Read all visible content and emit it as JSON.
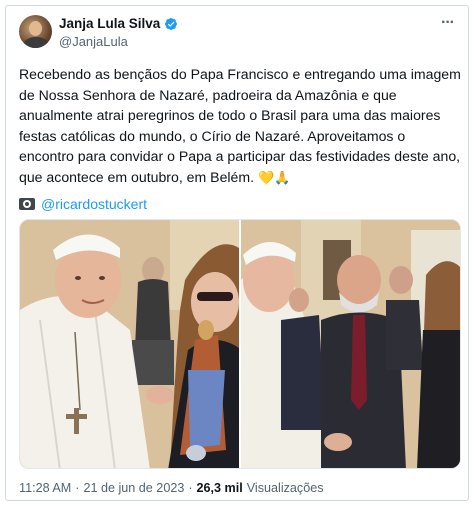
{
  "author": {
    "display_name": "Janja Lula Silva",
    "handle": "@JanjaLula",
    "verified": true
  },
  "tweet": {
    "text": "Recebendo as bençãos do Papa Francisco e entregando uma imagem de Nossa Senhora de Nazaré, padroeira da Amazônia e que anualmente atrai peregrinos de todo o Brasil para uma das maiores festas católicas do mundo, o Círio de Nazaré. Aproveitamos o encontro para convidar o Papa a participar das festividades deste ano, que acontece em outubro, em Belém.",
    "emojis": "💛🙏",
    "photo_credit": "@ricardostuckert"
  },
  "footer": {
    "time": "11:28 AM",
    "date": "21 de jun de 2023",
    "views_count": "26,3 mil",
    "views_label": "Visualizações",
    "separator": "·"
  },
  "icons": {
    "verified": "verified-badge-icon",
    "more": "more-options-icon",
    "camera": "camera-icon"
  },
  "colors": {
    "link": "#1d9bf0",
    "secondary_text": "#536471",
    "primary_text": "#0f1419"
  }
}
